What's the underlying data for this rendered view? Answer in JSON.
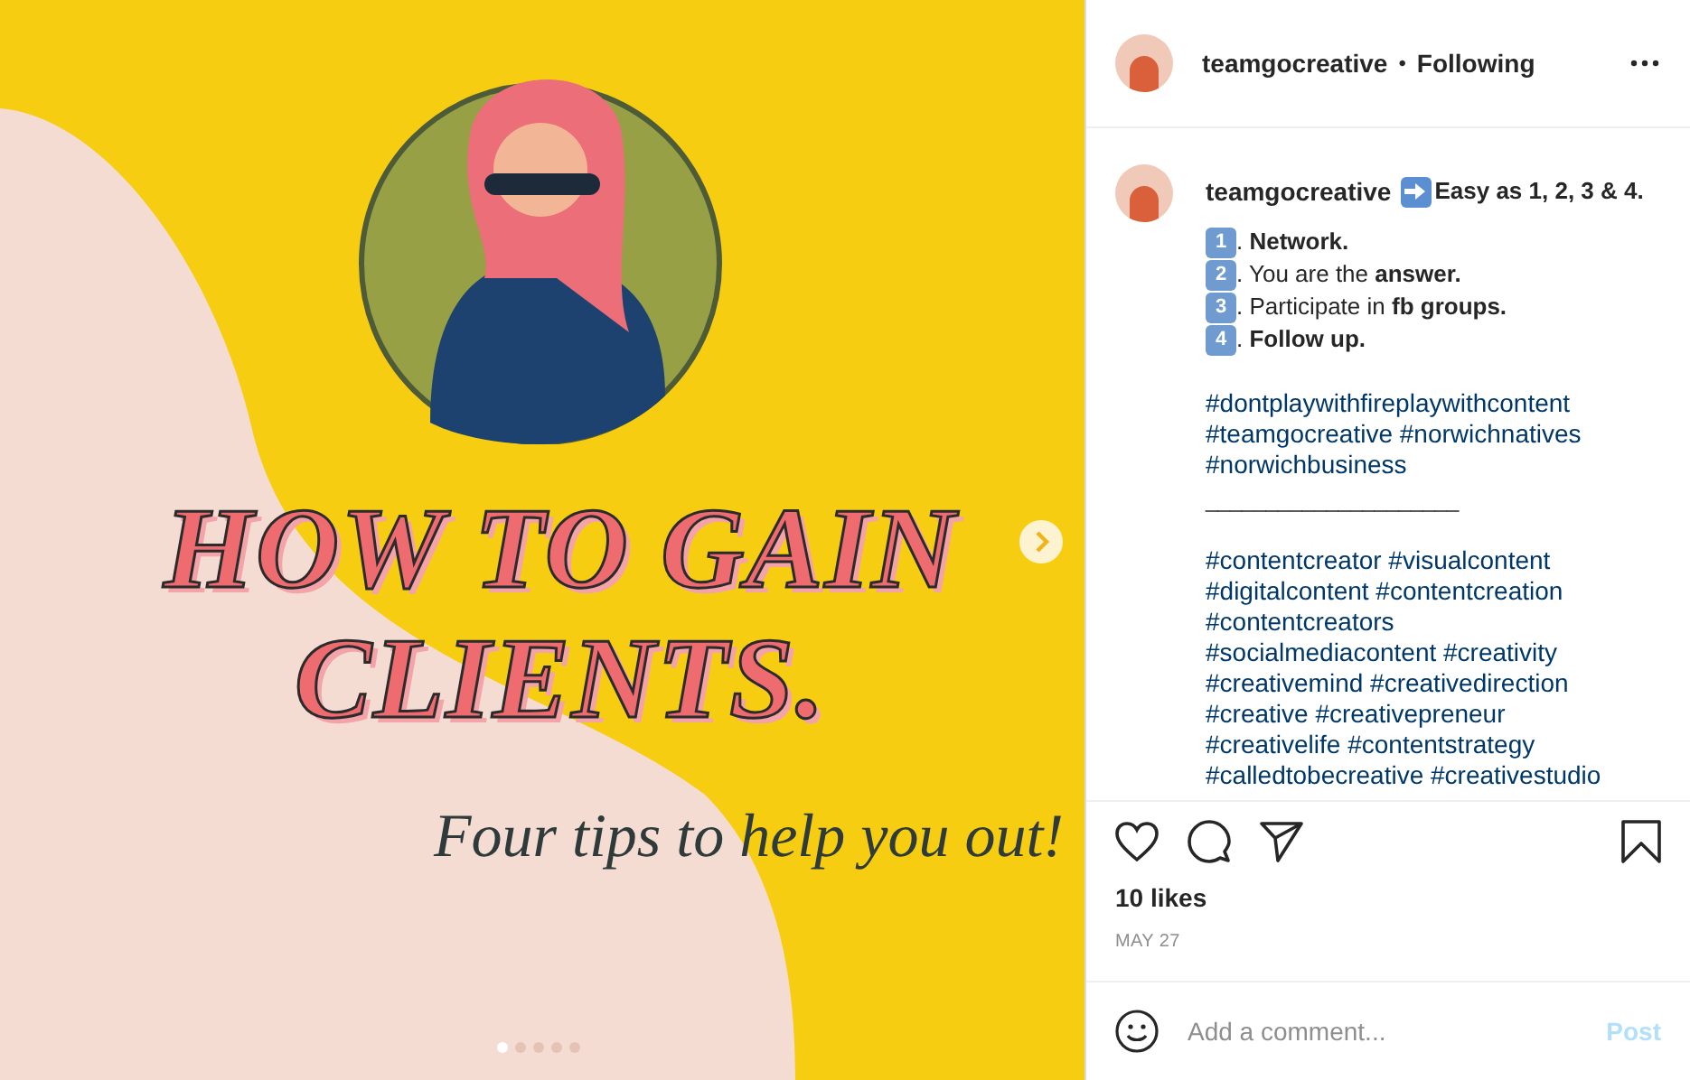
{
  "slide": {
    "headline": [
      "HOW TO GAIN",
      "CLIENTS."
    ],
    "subtitle": "Four tips to help you out!",
    "dots": [
      {
        "selected": true
      },
      {
        "selected": false
      },
      {
        "selected": false
      },
      {
        "selected": false
      },
      {
        "selected": false
      }
    ]
  },
  "header": {
    "username": "teamgocreative",
    "separator": "•",
    "follow_status": "Following"
  },
  "caption": {
    "username": "teamgocreative",
    "intro": "**Easy as 1, 2, 3 & 4.**",
    "tips": [
      {
        "number": "1",
        "text": ". **Network.**"
      },
      {
        "number": "2",
        "text": ". You are the **answer.**"
      },
      {
        "number": "3",
        "text": ". Participate in **fb groups.**"
      },
      {
        "number": "4",
        "text": ". **Follow up.**"
      }
    ],
    "hashtags_1": [
      "#dontplaywithfireplaywithcontent",
      "#teamgocreative #norwichnatives",
      "#norwichbusiness"
    ],
    "rule": "_____________________",
    "hashtags_2": [
      "#contentcreator #visualcontent",
      "#digitalcontent #contentcreation",
      "#contentcreators",
      "#socialmediacontent #creativity",
      "#creativemind #creativedirection",
      "#creative #creativepreneur",
      "#creativelife #contentstrategy",
      "#calledtobecreative #creativestudio"
    ]
  },
  "likes": "10 likes",
  "date": "MAY 27",
  "comment": {
    "placeholder": "Add a comment...",
    "post_label": "Post",
    "disabled": true
  }
}
